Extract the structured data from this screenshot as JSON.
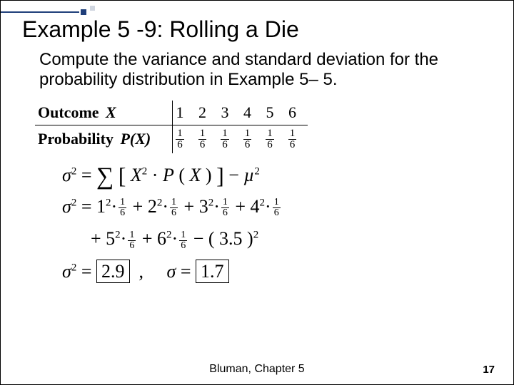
{
  "title": "Example 5 -9: Rolling a Die",
  "prompt": "Compute the variance and standard deviation for the probability distribution in Example 5– 5.",
  "table": {
    "row1_label": "Outcome",
    "row1_var": "X",
    "row2_label": "Probability",
    "row2_var": "P(X)",
    "outcomes": [
      "1",
      "2",
      "3",
      "4",
      "5",
      "6"
    ],
    "prob_num": "1",
    "prob_den": "6"
  },
  "eq": {
    "sigma": "σ",
    "mu": "µ",
    "sq": "2",
    "formula_inner": "X  · P ( X )",
    "frac_num": "1",
    "frac_den": "6",
    "terms": [
      "1",
      "2",
      "3",
      "4",
      "5",
      "6"
    ],
    "mean": "3.5",
    "variance": "2.9",
    "stdev": "1.7",
    "comma": ",",
    "eq_sign": "=",
    "plus": "+",
    "minus": "−",
    "dot": "·"
  },
  "footer": {
    "center": "Bluman, Chapter 5",
    "page": "17"
  },
  "chart_data": {
    "type": "table",
    "title": "Probability distribution for rolling a fair die",
    "categories": [
      1,
      2,
      3,
      4,
      5,
      6
    ],
    "values": [
      0.1667,
      0.1667,
      0.1667,
      0.1667,
      0.1667,
      0.1667
    ],
    "derived": {
      "mean": 3.5,
      "variance": 2.9,
      "stdev": 1.7
    }
  }
}
